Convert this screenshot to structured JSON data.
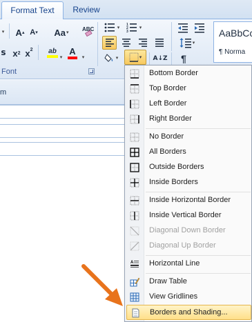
{
  "tabs": [
    {
      "label": "Format Text",
      "active": true
    },
    {
      "label": "Review",
      "active": false
    }
  ],
  "ribbon": {
    "font_group_label": "Font",
    "style_sample": "AaBbCcI",
    "style_name": "¶ Norma",
    "row1": {
      "grow_font": "A",
      "shrink_font": "A",
      "change_case": "Aa"
    },
    "row2": {
      "subscript": "x",
      "superscript": "x",
      "highlight": "ab",
      "font_color": "A"
    },
    "sort_icon": "A↓Z",
    "pilcrow": "¶"
  },
  "document": {
    "header_label": "m"
  },
  "menu": {
    "items": [
      {
        "label": "Bottom Border",
        "icon": "border-bottom-icon",
        "disabled": false
      },
      {
        "label": "Top Border",
        "icon": "border-top-icon",
        "disabled": false
      },
      {
        "label": "Left Border",
        "icon": "border-left-icon",
        "disabled": false
      },
      {
        "label": "Right Border",
        "icon": "border-right-icon",
        "disabled": false
      },
      {
        "label": "No Border",
        "icon": "border-none-icon",
        "disabled": false
      },
      {
        "label": "All Borders",
        "icon": "border-all-icon",
        "disabled": false
      },
      {
        "label": "Outside Borders",
        "icon": "border-outside-icon",
        "disabled": false
      },
      {
        "label": "Inside Borders",
        "icon": "border-inside-icon",
        "disabled": false
      },
      {
        "label": "Inside Horizontal Border",
        "icon": "border-inside-horizontal-icon",
        "disabled": false
      },
      {
        "label": "Inside Vertical Border",
        "icon": "border-inside-vertical-icon",
        "disabled": false
      },
      {
        "label": "Diagonal Down Border",
        "icon": "border-diagonal-down-icon",
        "disabled": true
      },
      {
        "label": "Diagonal Up Border",
        "icon": "border-diagonal-up-icon",
        "disabled": true
      },
      {
        "label": "Horizontal Line",
        "icon": "horizontal-line-icon",
        "disabled": false
      },
      {
        "label": "Draw Table",
        "icon": "draw-table-icon",
        "disabled": false
      },
      {
        "label": "View Gridlines",
        "icon": "view-gridlines-icon",
        "disabled": false
      },
      {
        "label": "Borders and Shading...",
        "icon": "borders-shading-icon",
        "disabled": false,
        "highlighted": true
      }
    ]
  },
  "colors": {
    "highlight_bar": "#ffff00",
    "font_color_bar": "#ff0000",
    "annotation_arrow": "#e8731c",
    "ribbon_accent": "#15428b"
  }
}
